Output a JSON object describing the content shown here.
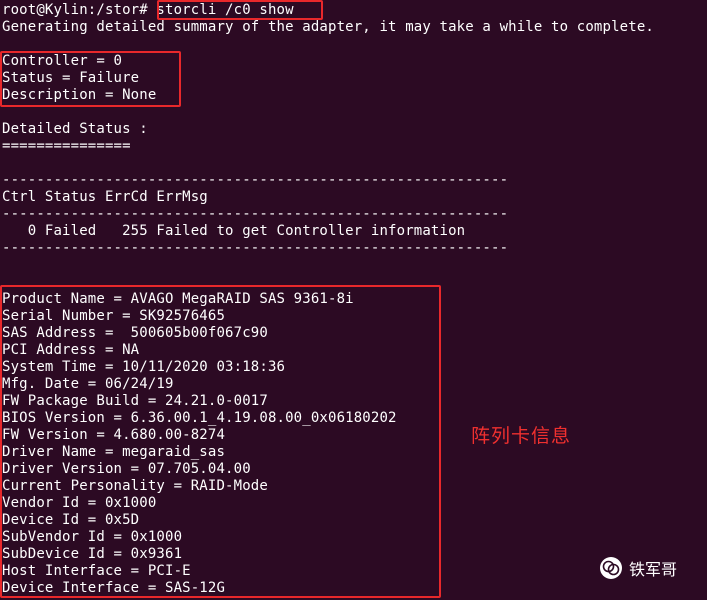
{
  "terminal": {
    "prompt": "root@Kylin:/stor#",
    "command": " storcli /c0 show",
    "lines": [
      "Generating detailed summary of the adapter, it may take a while to complete.",
      "",
      "Controller = 0",
      "Status = Failure",
      "Description = None",
      "",
      "Detailed Status :",
      "===============",
      "",
      "-----------------------------------------------------------",
      "Ctrl Status ErrCd ErrMsg",
      "-----------------------------------------------------------",
      "   0 Failed   255 Failed to get Controller information",
      "-----------------------------------------------------------",
      "",
      "",
      "Product Name = AVAGO MegaRAID SAS 9361-8i",
      "Serial Number = SK92576465",
      "SAS Address =  500605b00f067c90",
      "PCI Address = NA",
      "System Time = 10/11/2020 03:18:36",
      "Mfg. Date = 06/24/19",
      "FW Package Build = 24.21.0-0017",
      "BIOS Version = 6.36.00.1_4.19.08.00_0x06180202",
      "FW Version = 4.680.00-8274",
      "Driver Name = megaraid_sas",
      "Driver Version = 07.705.04.00",
      "Current Personality = RAID-Mode",
      "Vendor Id = 0x1000",
      "Device Id = 0x5D",
      "SubVendor Id = 0x1000",
      "SubDevice Id = 0x9361",
      "Host Interface = PCI-E",
      "Device Interface = SAS-12G"
    ]
  },
  "annotation": {
    "label": "阵列卡信息",
    "color": "#e8282b"
  },
  "watermark": {
    "text": "铁军哥",
    "icon": "wechat-official-account-icon"
  }
}
